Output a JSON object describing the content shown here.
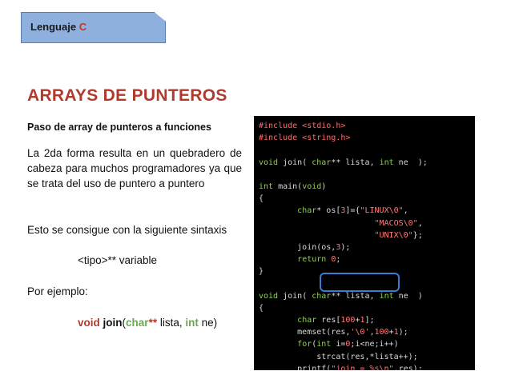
{
  "header": {
    "tag_label": "Lenguaje",
    "tag_letter": "C"
  },
  "title": "ARRAYS DE PUNTEROS",
  "subtitle": "Paso de array de punteros a funciones",
  "paragraph": "La 2da forma resulta en un quebradero de cabeza para muchos programadores ya que se trata del uso de puntero a puntero",
  "syntax_intro": "Esto se consigue con la siguiente sintaxis",
  "syntax": "<tipo>** variable",
  "example_intro": "Por ejemplo:",
  "example": {
    "void": "void",
    "fn": "join",
    "open": "(",
    "type": "char",
    "stars": "**",
    "arg1": " lista, ",
    "int": "int",
    "arg2": " ne)"
  },
  "code": [
    {
      "segments": [
        {
          "t": "#include <stdio.h>",
          "c": "pp"
        }
      ]
    },
    {
      "segments": [
        {
          "t": "#include <string.h>",
          "c": "pp"
        }
      ]
    },
    {
      "segments": [
        {
          "t": "",
          "c": ""
        }
      ]
    },
    {
      "segments": [
        {
          "t": "void",
          "c": "ty"
        },
        {
          "t": " join( ",
          "c": ""
        },
        {
          "t": "char",
          "c": "ty"
        },
        {
          "t": "** lista, ",
          "c": ""
        },
        {
          "t": "int",
          "c": "ty"
        },
        {
          "t": " ne  );",
          "c": ""
        }
      ]
    },
    {
      "segments": [
        {
          "t": "",
          "c": ""
        }
      ]
    },
    {
      "segments": [
        {
          "t": "int",
          "c": "ty"
        },
        {
          "t": " main(",
          "c": ""
        },
        {
          "t": "void",
          "c": "ty"
        },
        {
          "t": ")",
          "c": ""
        }
      ]
    },
    {
      "segments": [
        {
          "t": "{",
          "c": ""
        }
      ]
    },
    {
      "segments": [
        {
          "t": "        ",
          "c": ""
        },
        {
          "t": "char",
          "c": "ty"
        },
        {
          "t": "* os[",
          "c": ""
        },
        {
          "t": "3",
          "c": "st"
        },
        {
          "t": "]={",
          "c": ""
        },
        {
          "t": "\"LINUX\\0\"",
          "c": "st"
        },
        {
          "t": ",",
          "c": ""
        }
      ]
    },
    {
      "segments": [
        {
          "t": "                        ",
          "c": ""
        },
        {
          "t": "\"MACOS\\0\"",
          "c": "st"
        },
        {
          "t": ",",
          "c": ""
        }
      ]
    },
    {
      "segments": [
        {
          "t": "                        ",
          "c": ""
        },
        {
          "t": "\"UNIX\\0\"",
          "c": "st"
        },
        {
          "t": "};",
          "c": ""
        }
      ]
    },
    {
      "segments": [
        {
          "t": "        join(os,",
          "c": ""
        },
        {
          "t": "3",
          "c": "st"
        },
        {
          "t": ");",
          "c": ""
        }
      ]
    },
    {
      "segments": [
        {
          "t": "        ",
          "c": ""
        },
        {
          "t": "return",
          "c": "ty"
        },
        {
          "t": " ",
          "c": ""
        },
        {
          "t": "0",
          "c": "st"
        },
        {
          "t": ";",
          "c": ""
        }
      ]
    },
    {
      "segments": [
        {
          "t": "}",
          "c": ""
        }
      ]
    },
    {
      "segments": [
        {
          "t": "",
          "c": ""
        }
      ]
    },
    {
      "segments": [
        {
          "t": "void",
          "c": "ty"
        },
        {
          "t": " join( ",
          "c": ""
        },
        {
          "t": "char",
          "c": "ty"
        },
        {
          "t": "** lista, ",
          "c": ""
        },
        {
          "t": "int",
          "c": "ty"
        },
        {
          "t": " ne  )",
          "c": ""
        }
      ]
    },
    {
      "segments": [
        {
          "t": "{",
          "c": ""
        }
      ]
    },
    {
      "segments": [
        {
          "t": "        ",
          "c": ""
        },
        {
          "t": "char",
          "c": "ty"
        },
        {
          "t": " res[",
          "c": ""
        },
        {
          "t": "100",
          "c": "st"
        },
        {
          "t": "+",
          "c": ""
        },
        {
          "t": "1",
          "c": "st"
        },
        {
          "t": "];",
          "c": ""
        }
      ]
    },
    {
      "segments": [
        {
          "t": "        memset(res,",
          "c": ""
        },
        {
          "t": "'\\0'",
          "c": "st"
        },
        {
          "t": ",",
          "c": ""
        },
        {
          "t": "100",
          "c": "st"
        },
        {
          "t": "+",
          "c": ""
        },
        {
          "t": "1",
          "c": "st"
        },
        {
          "t": ");",
          "c": ""
        }
      ]
    },
    {
      "segments": [
        {
          "t": "        ",
          "c": ""
        },
        {
          "t": "for",
          "c": "ty"
        },
        {
          "t": "(",
          "c": ""
        },
        {
          "t": "int",
          "c": "ty"
        },
        {
          "t": " i=",
          "c": ""
        },
        {
          "t": "0",
          "c": "st"
        },
        {
          "t": ";i<ne;i++)",
          "c": ""
        }
      ]
    },
    {
      "segments": [
        {
          "t": "            strcat(res,*lista++);",
          "c": ""
        }
      ]
    },
    {
      "segments": [
        {
          "t": "        printf(",
          "c": ""
        },
        {
          "t": "\"join = %s\\n\"",
          "c": "st"
        },
        {
          "t": ",res);",
          "c": ""
        }
      ]
    },
    {
      "segments": [
        {
          "t": "}",
          "c": ""
        }
      ]
    }
  ]
}
